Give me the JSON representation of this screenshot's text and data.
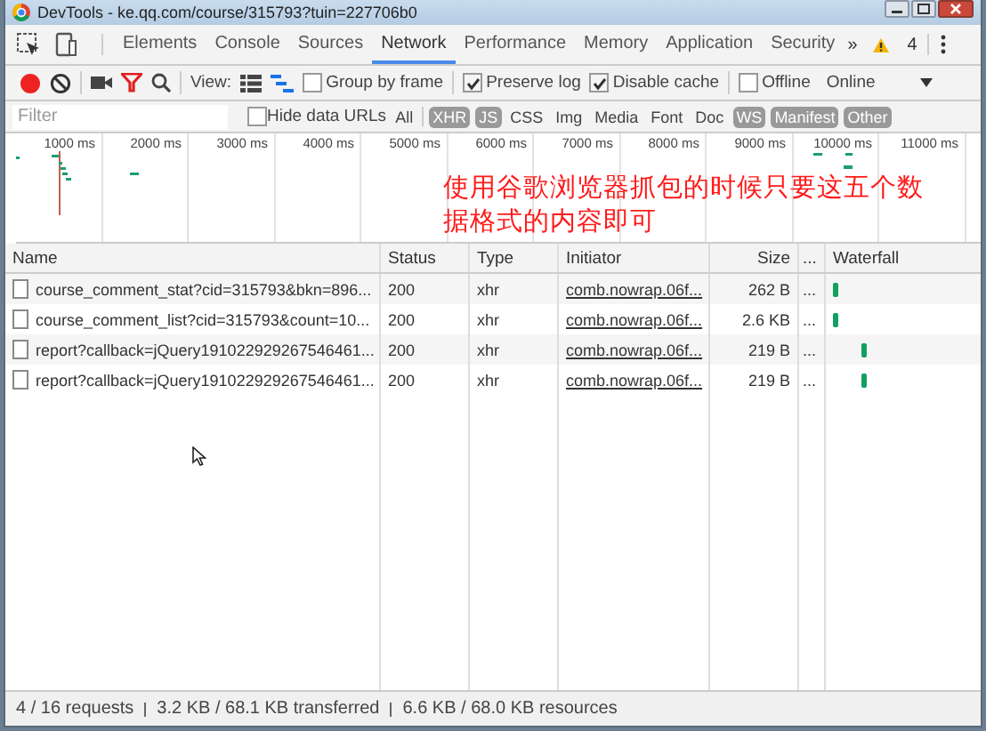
{
  "window": {
    "title": "DevTools - ke.qq.com/course/315793?tuin=227706b0"
  },
  "tabs": [
    {
      "label": "Elements",
      "selected": false
    },
    {
      "label": "Console",
      "selected": false
    },
    {
      "label": "Sources",
      "selected": false
    },
    {
      "label": "Network",
      "selected": true
    },
    {
      "label": "Performance",
      "selected": false
    },
    {
      "label": "Memory",
      "selected": false
    },
    {
      "label": "Application",
      "selected": false
    },
    {
      "label": "Security",
      "selected": false
    }
  ],
  "more_tabs": "»",
  "warnings": "4",
  "toolbar": {
    "view_label": "View:",
    "options": [
      {
        "label": "Group by frame",
        "checked": false
      },
      {
        "label": "Preserve log",
        "checked": true
      },
      {
        "label": "Disable cache",
        "checked": true
      },
      {
        "label": "Offline",
        "checked": false
      }
    ],
    "throttle": "Online"
  },
  "filter": {
    "placeholder": "Filter",
    "hide_data_urls": {
      "label": "Hide data URLs",
      "checked": false
    },
    "types": [
      {
        "label": "All",
        "selected": false
      },
      {
        "label": "XHR",
        "selected": true
      },
      {
        "label": "JS",
        "selected": true
      },
      {
        "label": "CSS",
        "selected": false
      },
      {
        "label": "Img",
        "selected": false
      },
      {
        "label": "Media",
        "selected": false
      },
      {
        "label": "Font",
        "selected": false
      },
      {
        "label": "Doc",
        "selected": false
      },
      {
        "label": "WS",
        "selected": true
      },
      {
        "label": "Manifest",
        "selected": true
      },
      {
        "label": "Other",
        "selected": true
      }
    ]
  },
  "overview": {
    "ticks": [
      "1000 ms",
      "2000 ms",
      "3000 ms",
      "4000 ms",
      "5000 ms",
      "6000 ms",
      "7000 ms",
      "8000 ms",
      "9000 ms",
      "10000 ms",
      "11000 ms"
    ]
  },
  "annotation": "使用谷歌浏览器抓包的时候只要这五个数据格式的内容即可",
  "table": {
    "columns": [
      "Name",
      "Status",
      "Type",
      "Initiator",
      "Size",
      "...",
      "Waterfall"
    ],
    "rows": [
      {
        "name": "course_comment_stat?cid=315793&bkn=896...",
        "status": "200",
        "type": "xhr",
        "initiator": "comb.nowrap.06f...",
        "size": "262 B",
        "more": "..."
      },
      {
        "name": "course_comment_list?cid=315793&count=10...",
        "status": "200",
        "type": "xhr",
        "initiator": "comb.nowrap.06f...",
        "size": "2.6 KB",
        "more": "..."
      },
      {
        "name": "report?callback=jQuery191022929267546461...",
        "status": "200",
        "type": "xhr",
        "initiator": "comb.nowrap.06f...",
        "size": "219 B",
        "more": "..."
      },
      {
        "name": "report?callback=jQuery191022929267546461...",
        "status": "200",
        "type": "xhr",
        "initiator": "comb.nowrap.06f...",
        "size": "219 B",
        "more": "..."
      }
    ]
  },
  "status_bar": [
    "4 / 16 requests",
    "3.2 KB / 68.1 KB transferred",
    "6.6 KB / 68.0 KB resources"
  ]
}
